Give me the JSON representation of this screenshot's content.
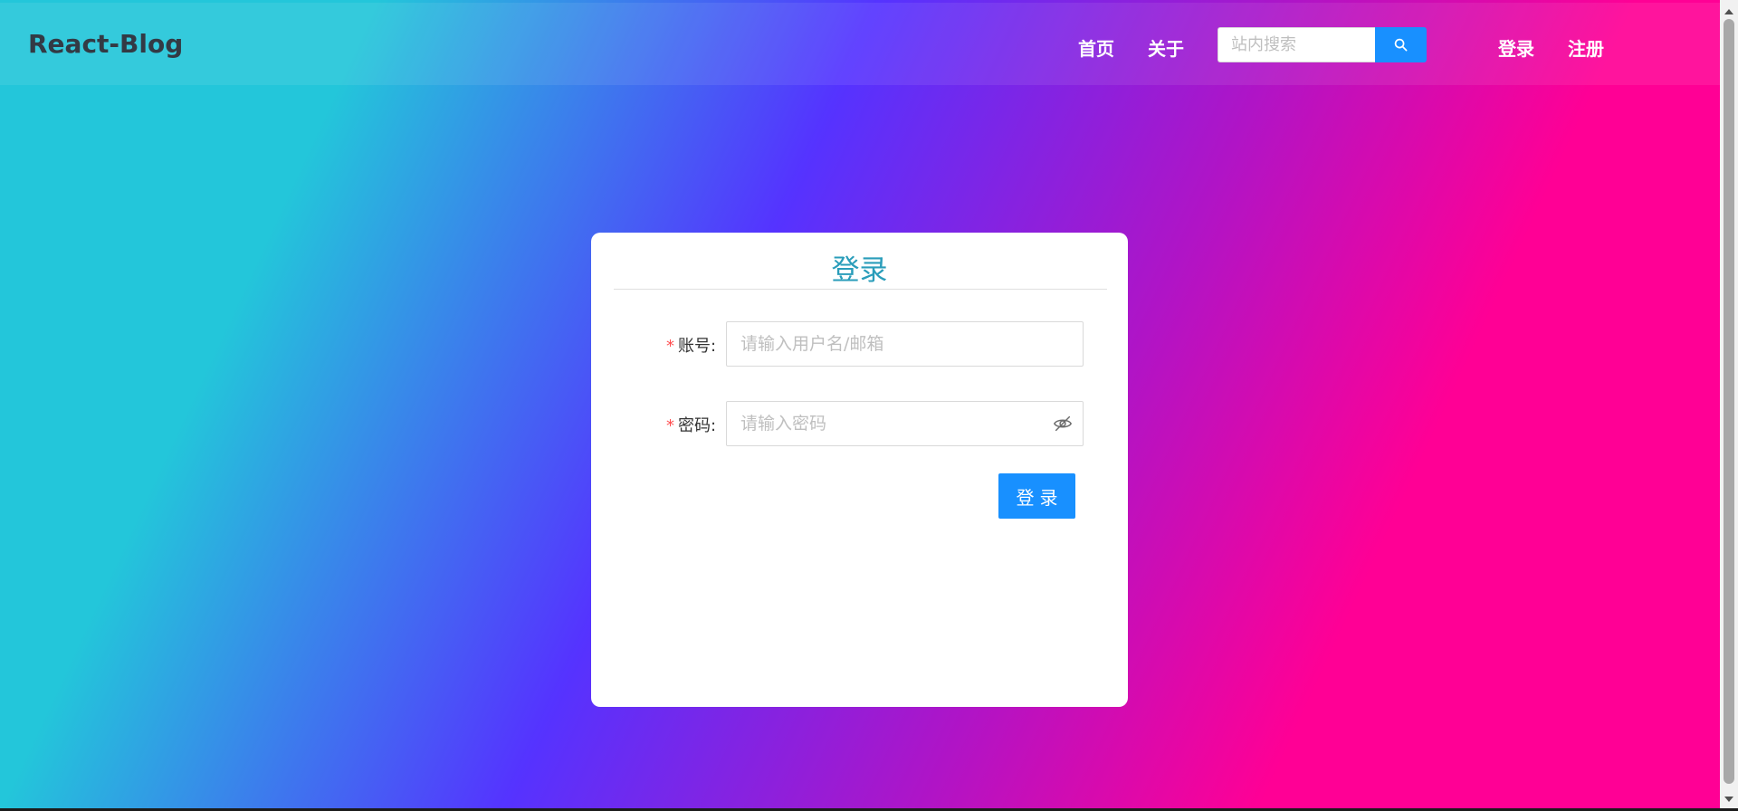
{
  "header": {
    "brand": "React-Blog",
    "nav": {
      "home": "首页",
      "about": "关于",
      "login": "登录",
      "register": "注册"
    },
    "search": {
      "placeholder": "站内搜索",
      "value": ""
    }
  },
  "login_card": {
    "title": "登录",
    "account": {
      "label": "账号:",
      "required_mark": "*",
      "placeholder": "请输入用户名/邮箱",
      "value": ""
    },
    "password": {
      "label": "密码:",
      "required_mark": "*",
      "placeholder": "请输入密码",
      "value": ""
    },
    "submit_label": "登录"
  },
  "icons": {
    "search": "search-icon",
    "password_toggle": "eye-invisible-icon"
  },
  "colors": {
    "accent": "#1890ff",
    "title": "#2a9dba",
    "required": "#ff4d4f",
    "gradient_start": "#23c6da",
    "gradient_mid": "#5533ff",
    "gradient_end": "#ff0095"
  }
}
